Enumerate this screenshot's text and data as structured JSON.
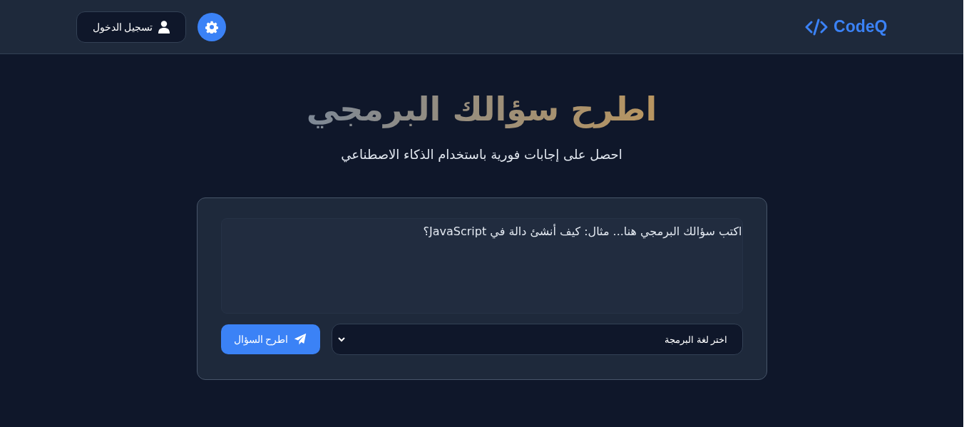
{
  "header": {
    "logo": "CodeQ",
    "buttons": [
      {
        "kind": "settings"
      },
      {
        "kind": "login",
        "label": "تسجيل الدخول"
      }
    ]
  },
  "hero": {
    "title": "اطرح سؤالك البرمجي",
    "subtitle": "احصل على إجابات فورية باستخدام الذكاء الاصطناعي"
  },
  "form": {
    "question": {
      "placeholder": "اكتب سؤالك البرمجي هنا... مثال: كيف أنشئ دالة في JavaScript؟"
    },
    "language_select": {
      "value": "اختر لغة البرمجة"
    },
    "submit": {
      "label": "اطرح السؤال"
    }
  }
}
